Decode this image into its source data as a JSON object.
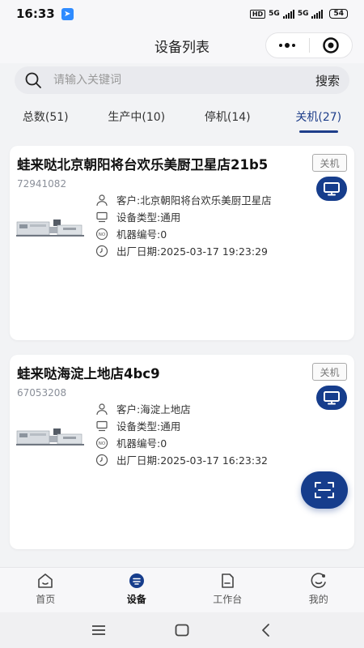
{
  "status_bar": {
    "time": "16:33",
    "network_hd": "HD",
    "network_1": "5G",
    "network_2": "5G",
    "battery": "54"
  },
  "nav": {
    "title": "设备列表"
  },
  "search": {
    "placeholder": "请输入关键词",
    "button_label": "搜索"
  },
  "tabs": [
    {
      "label": "总数(51)",
      "active": false
    },
    {
      "label": "生产中(10)",
      "active": false
    },
    {
      "label": "停机(14)",
      "active": false
    },
    {
      "label": "关机(27)",
      "active": true
    }
  ],
  "devices": [
    {
      "name": "蛙来哒北京朝阳将台欢乐美厨卫星店21b5",
      "code": "72941082",
      "status": "关机",
      "customer": "客户:北京朝阳将台欢乐美厨卫星店",
      "type": "设备类型:通用",
      "machine_no": "机器编号:0",
      "factory_date": "出厂日期:2025-03-17 19:23:29"
    },
    {
      "name": "蛙来哒海淀上地店4bc9",
      "code": "67053208",
      "status": "关机",
      "customer": "客户:海淀上地店",
      "type": "设备类型:通用",
      "machine_no": "机器编号:0",
      "factory_date": "出厂日期:2025-03-17 16:23:32"
    }
  ],
  "tabbar": [
    {
      "label": "首页",
      "icon": "home-icon",
      "active": false
    },
    {
      "label": "设备",
      "icon": "device-icon",
      "active": true
    },
    {
      "label": "工作台",
      "icon": "workbench-icon",
      "active": false
    },
    {
      "label": "我的",
      "icon": "profile-icon",
      "active": false
    }
  ],
  "colors": {
    "primary": "#163d8c",
    "active_tab": "#1e3e8a",
    "background": "#f2f3f5"
  }
}
